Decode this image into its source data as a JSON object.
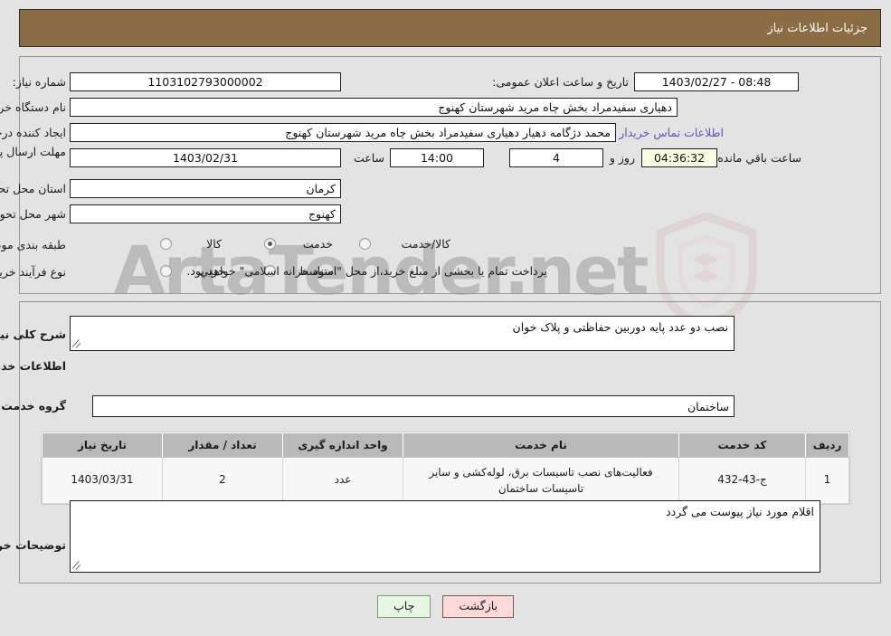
{
  "header": {
    "title": "جزئیات اطلاعات نیاز"
  },
  "form": {
    "need_number_label": "شماره نیاز:",
    "need_number_value": "1103102793000002",
    "announce_label": "تاریخ و ساعت اعلان عمومی:",
    "announce_value": "08:48 - 1403/02/27",
    "buyer_org_label": "نام دستگاه خریدار:",
    "buyer_org_value": "دهیاری سفیدمراد بخش چاه مرید شهرستان کهنوج",
    "creator_label": "ایجاد کننده درخواست:",
    "creator_value": "محمد دژگامه دهیار دهیاری سفیدمراد بخش چاه مرید شهرستان کهنوج",
    "contact_link": "اطلاعات تماس خریدار",
    "deadline_label": "مهلت ارسال پاسخ: تا تاریخ:",
    "deadline_date": "1403/02/31",
    "hour_label": "ساعت",
    "hour_value": "14:00",
    "days_value": "4",
    "days_suffix": "روز و",
    "timer_value": "04:36:32",
    "timer_suffix": "ساعت باقي مانده",
    "province_label": "استان محل تحویل:",
    "province_value": "کرمان",
    "city_label": "شهر محل تحویل:",
    "city_value": "کهنوج",
    "category_label": "طبقه بندی موضوعی:",
    "category_options": [
      {
        "label": "کالا",
        "checked": false
      },
      {
        "label": "خدمت",
        "checked": true
      },
      {
        "label": "کالا/خدمت",
        "checked": false
      }
    ],
    "process_label": "نوع فرآیند خرید :",
    "process_options": [
      {
        "label": "جزیي",
        "checked": false
      },
      {
        "label": "متوسط",
        "checked": false
      }
    ],
    "treasury_note": "پرداخت تمام یا بخشی از مبلغ خرید،از محل \"اسناد خزانه اسلامی\" خواهد بود."
  },
  "need_desc": {
    "label": "شرح کلی نیاز:",
    "value": "نصب دو عدد پایه دوربین حفاظتی و پلاک خوان"
  },
  "services_section": {
    "heading": "اطلاعات خدمات مورد نیاز",
    "group_label": "گروه خدمت:",
    "group_value": "ساختمان"
  },
  "table": {
    "columns": [
      "ردیف",
      "کد خدمت",
      "نام خدمت",
      "واحد اندازه گیری",
      "تعداد / مقدار",
      "تاریخ نیاز"
    ],
    "rows": [
      {
        "row_no": "1",
        "service_code": "ج-43-432",
        "service_name": "فعالیت‌های نصب تاسیسات برق، لوله‌کشی و سایر تاسیسات ساختمان",
        "unit": "عدد",
        "quantity": "2",
        "need_date": "1403/03/31"
      }
    ]
  },
  "buyer_notes": {
    "label": "توضیحات خریدار:",
    "value": "اقلام مورد نیاز پیوست می گردد"
  },
  "buttons": {
    "print": "چاپ",
    "back": "بازگشت"
  },
  "watermark": {
    "text": "ArtaTender.net"
  },
  "colors": {
    "header_bg": "#8b6c45",
    "page_bg": "#e3e3e3",
    "link": "#6a4fbf",
    "timer_bg": "#fbfbe4",
    "table_header_bg": "#b9b9b9",
    "print_btn_bg": "#e8f6e4",
    "back_btn_bg": "#fbd9d9"
  }
}
